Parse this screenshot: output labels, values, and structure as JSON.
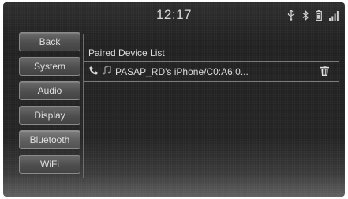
{
  "status": {
    "time": "12:17",
    "icons": [
      "usb-icon",
      "bluetooth-icon",
      "battery-icon",
      "signal-icon"
    ]
  },
  "sidebar": {
    "items": [
      {
        "label": "Back"
      },
      {
        "label": "System"
      },
      {
        "label": "Audio"
      },
      {
        "label": "Display"
      },
      {
        "label": "Bluetooth",
        "active": true
      },
      {
        "label": "WiFi"
      }
    ]
  },
  "panel": {
    "title": "Paired Device List",
    "devices": [
      {
        "name": "PASAP_RD's iPhone/C0:A6:0...",
        "icons": [
          "phone-icon",
          "music-note-icon",
          "trash-icon"
        ]
      }
    ]
  }
}
